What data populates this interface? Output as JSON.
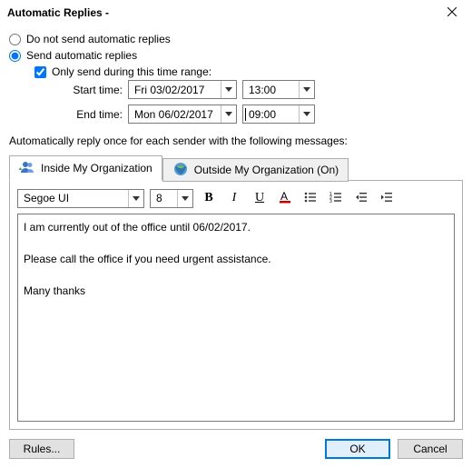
{
  "window": {
    "title": "Automatic Replies -"
  },
  "radios": {
    "dont_send": "Do not send automatic replies",
    "send": "Send automatic replies",
    "selected": "send"
  },
  "time_range": {
    "checkbox_label": "Only send during this time range:",
    "checked": true,
    "start_label": "Start time:",
    "start_date": "Fri 03/02/2017",
    "start_time": "13:00",
    "end_label": "End time:",
    "end_date": "Mon 06/02/2017",
    "end_time": "09:00"
  },
  "section_label": "Automatically reply once for each sender with the following messages:",
  "tabs": {
    "inside": "Inside My Organization",
    "outside": "Outside My Organization (On)",
    "active": "inside"
  },
  "editor": {
    "font": "Segoe UI",
    "size": "8",
    "text": "I am currently out of the office until 06/02/2017.\n\nPlease call the office if you need urgent assistance.\n\nMany thanks"
  },
  "buttons": {
    "rules": "Rules...",
    "ok": "OK",
    "cancel": "Cancel"
  }
}
